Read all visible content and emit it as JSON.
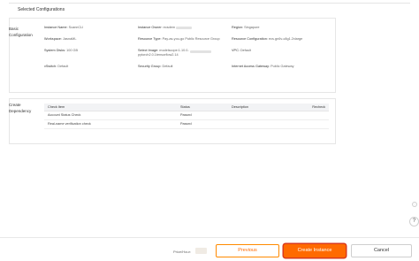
{
  "section_title": "Selected Configurations",
  "basic": {
    "label_line1": "Basic",
    "label_line2": "Configuration",
    "rows": [
      [
        {
          "key": "Instance Name:",
          "value": "ScannCLI"
        },
        {
          "key": "Instance Owner:",
          "value": "ecsdem"
        },
        {
          "key": "Region:",
          "value": "Singapore"
        }
      ],
      [
        {
          "key": "Workspace:",
          "value": "JasnaML"
        },
        {
          "key": "Resource Type:",
          "value": "Pay-as-you-go Public Resource Group"
        },
        {
          "key": "Resource Configuration:",
          "value": "ecs.gn6v-c8g1.2xlarge"
        }
      ],
      [
        {
          "key": "System Disks:",
          "value": "100 GB"
        },
        {
          "key": "Select Image:",
          "value": "modelscope:1.10.0-pytorch2.0.1tensorflow2.14"
        },
        {
          "key": "VPC:",
          "value": "Default"
        }
      ],
      [
        {
          "key": "vSwitch:",
          "value": "Default"
        },
        {
          "key": "Security Group:",
          "value": "Default"
        },
        {
          "key": "Internet Access Gateway:",
          "value": "Public Gateway"
        }
      ]
    ]
  },
  "dependency": {
    "label_line1": "Create",
    "label_line2": "Dependency",
    "columns": [
      "Check Item",
      "Status",
      "Description"
    ],
    "recheck": "Recheck",
    "rows": [
      {
        "item": "Account Status Check",
        "status": "Passed"
      },
      {
        "item": "Real-name verification check",
        "status": "Passed"
      }
    ]
  },
  "footer": {
    "price_label": "Price/Hour:",
    "previous": "Previous",
    "create": "Create Instance",
    "cancel": "Cancel"
  },
  "help_icon": "question-icon",
  "colors": {
    "accent": "#ff6a00",
    "passed": "#1aa35c",
    "link": "#1a73e8"
  }
}
